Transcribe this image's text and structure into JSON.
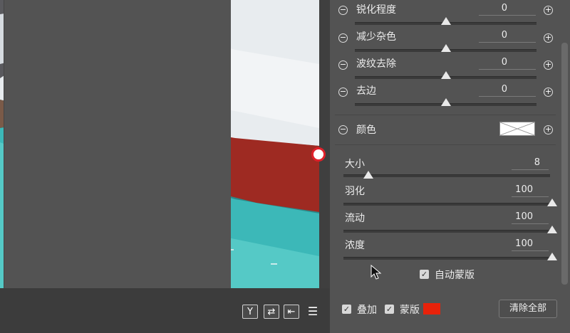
{
  "sliders_top": [
    {
      "label": "锐化程度",
      "value": "0",
      "level": 0.5
    },
    {
      "label": "减少杂色",
      "value": "0",
      "level": 0.5
    },
    {
      "label": "波纹去除",
      "value": "0",
      "level": 0.5
    },
    {
      "label": "去边",
      "value": "0",
      "level": 0.5
    }
  ],
  "color": {
    "label": "颜色"
  },
  "brush": [
    {
      "label": "大小",
      "value": "8",
      "level": 0.08
    },
    {
      "label": "羽化",
      "value": "100",
      "level": 1.0
    },
    {
      "label": "流动",
      "value": "100",
      "level": 1.0
    },
    {
      "label": "浓度",
      "value": "100",
      "level": 1.0
    }
  ],
  "auto_mask": {
    "label": "自动蒙版",
    "checked": true
  },
  "overlay": {
    "label": "叠加",
    "checked": true
  },
  "mask": {
    "label": "蒙版",
    "checked": true,
    "color": "#e8220a"
  },
  "clear_all": "清除全部",
  "toolbar_icons": [
    "y-dropdown-icon",
    "swap-icon",
    "arrow-left-box-icon",
    "sliders-icon"
  ],
  "toolbar_y": "Y",
  "colors": {
    "mask_overlay": "#9e2a22",
    "panel_bg": "#535353"
  }
}
